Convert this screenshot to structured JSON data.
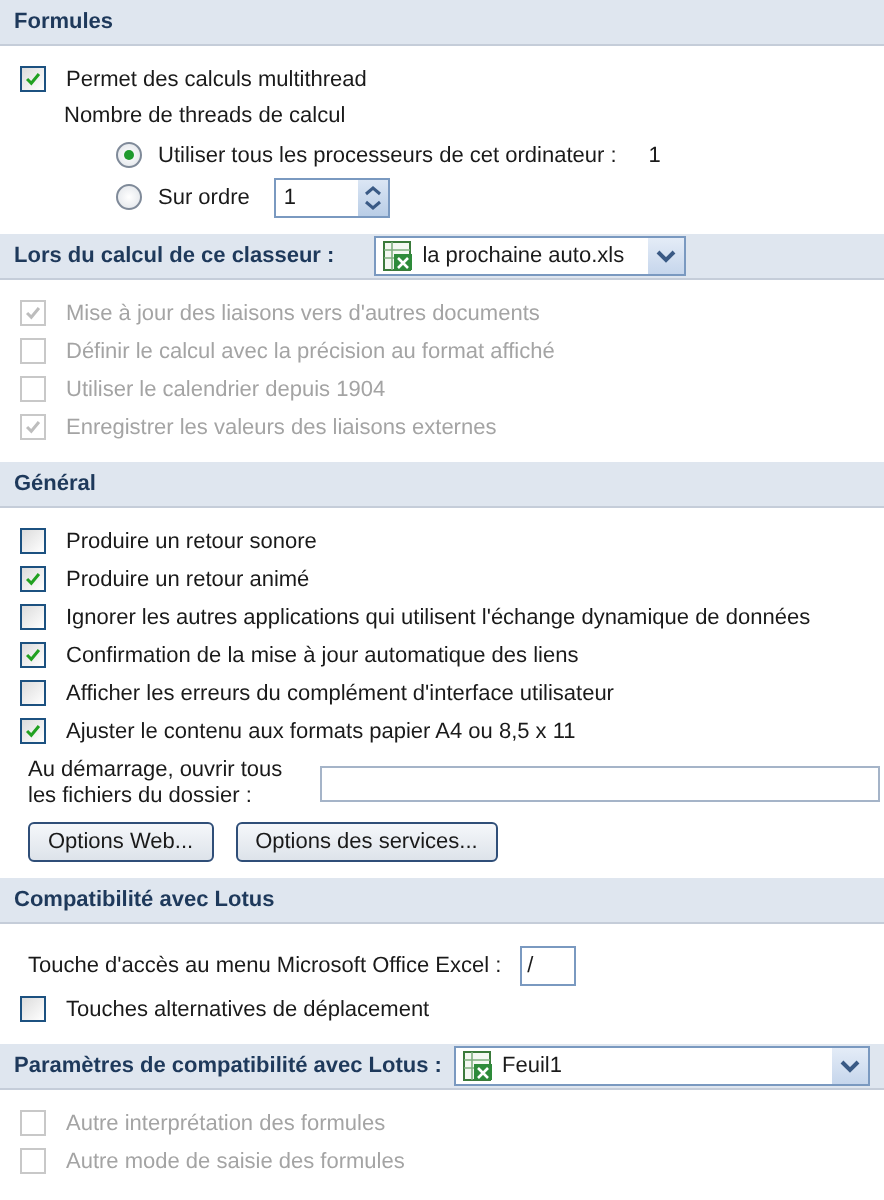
{
  "sections": [
    {
      "title": "Formules",
      "items": [
        {
          "kind": "checkbox",
          "label": "Permet des calculs multithread",
          "checked": true,
          "disabled": false
        },
        {
          "kind": "label",
          "text": "Nombre de threads de calcul"
        },
        {
          "kind": "radio",
          "label": "Utiliser tous les processeurs de cet ordinateur :",
          "selected": true,
          "value": "1"
        },
        {
          "kind": "radio_spin",
          "label": "Sur ordre",
          "selected": false,
          "value": "1"
        }
      ]
    },
    {
      "title": "Lors du calcul de ce classeur :",
      "dropdown": {
        "value": "la prochaine auto.xls",
        "wide": false
      },
      "items": [
        {
          "kind": "checkbox",
          "label": "Mise à jour des liaisons vers d'autres documents",
          "checked": true,
          "disabled": true
        },
        {
          "kind": "checkbox",
          "label": "Définir le calcul avec la précision au format affiché",
          "checked": false,
          "disabled": true
        },
        {
          "kind": "checkbox",
          "label": "Utiliser le calendrier depuis 1904",
          "checked": false,
          "disabled": true
        },
        {
          "kind": "checkbox",
          "label": "Enregistrer les valeurs des liaisons externes",
          "checked": true,
          "disabled": true
        }
      ]
    },
    {
      "title": "Général",
      "items": [
        {
          "kind": "checkbox",
          "label": "Produire un retour sonore",
          "checked": false,
          "disabled": false
        },
        {
          "kind": "checkbox",
          "label": "Produire un retour animé",
          "checked": true,
          "disabled": false
        },
        {
          "kind": "checkbox",
          "label": "Ignorer les autres applications qui utilisent l'échange dynamique de données",
          "checked": false,
          "disabled": false
        },
        {
          "kind": "checkbox",
          "label": "Confirmation de la mise à jour automatique des liens",
          "checked": true,
          "disabled": false
        },
        {
          "kind": "checkbox",
          "label": "Afficher les erreurs du complément d'interface utilisateur",
          "checked": false,
          "disabled": false
        },
        {
          "kind": "checkbox",
          "label": "Ajuster le contenu aux formats papier A4 ou 8,5 x 11",
          "checked": true,
          "disabled": false
        },
        {
          "kind": "text_field",
          "label": "Au démarrage, ouvrir tous les fichiers du dossier :"
        },
        {
          "kind": "buttons",
          "buttons": [
            "Options Web...",
            "Options des services..."
          ]
        }
      ]
    },
    {
      "title": "Compatibilité avec Lotus",
      "items": [
        {
          "kind": "key_field",
          "label": "Touche d'accès au menu Microsoft Office Excel :",
          "value": "/"
        },
        {
          "kind": "checkbox",
          "label": "Touches alternatives de déplacement",
          "checked": false,
          "disabled": false
        }
      ]
    },
    {
      "title": "Paramètres de compatibilité avec Lotus :",
      "dropdown": {
        "value": "Feuil1",
        "wide": true
      },
      "items": [
        {
          "kind": "checkbox",
          "label": "Autre interprétation des formules",
          "checked": false,
          "disabled": true
        },
        {
          "kind": "checkbox",
          "label": "Autre mode de saisie des formules",
          "checked": false,
          "disabled": true
        }
      ]
    }
  ]
}
